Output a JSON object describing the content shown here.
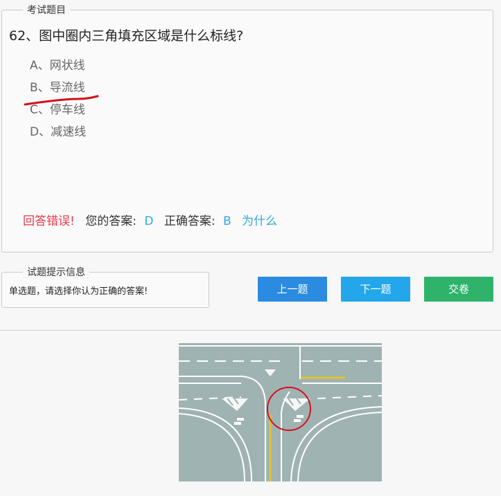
{
  "question_panel": {
    "legend": "考试题目",
    "question": "62、图中圈内三角填充区域是什么标线?",
    "options": [
      {
        "label": "A、网状线"
      },
      {
        "label": "B、导流线"
      },
      {
        "label": "C、停车线"
      },
      {
        "label": "D、减速线"
      }
    ]
  },
  "result": {
    "wrong_text": "回答错误!",
    "your_answer_label": "您的答案:",
    "your_answer_value": "D",
    "correct_label": "正确答案:",
    "correct_value": "B",
    "why_link": "为什么"
  },
  "hint_panel": {
    "legend": "试题提示信息",
    "text": "单选题，请选择你认为正确的答案!"
  },
  "buttons": {
    "prev": "上一题",
    "next": "下一题",
    "submit": "交卷"
  },
  "colors": {
    "wrong": "#e8394a",
    "answer_blue": "#31a8e0",
    "prev_btn": "#2a8be0",
    "next_btn": "#24a7ea",
    "submit_btn": "#2fb36b",
    "road": "#9fb2b2",
    "annotation_red": "#d4101a"
  }
}
